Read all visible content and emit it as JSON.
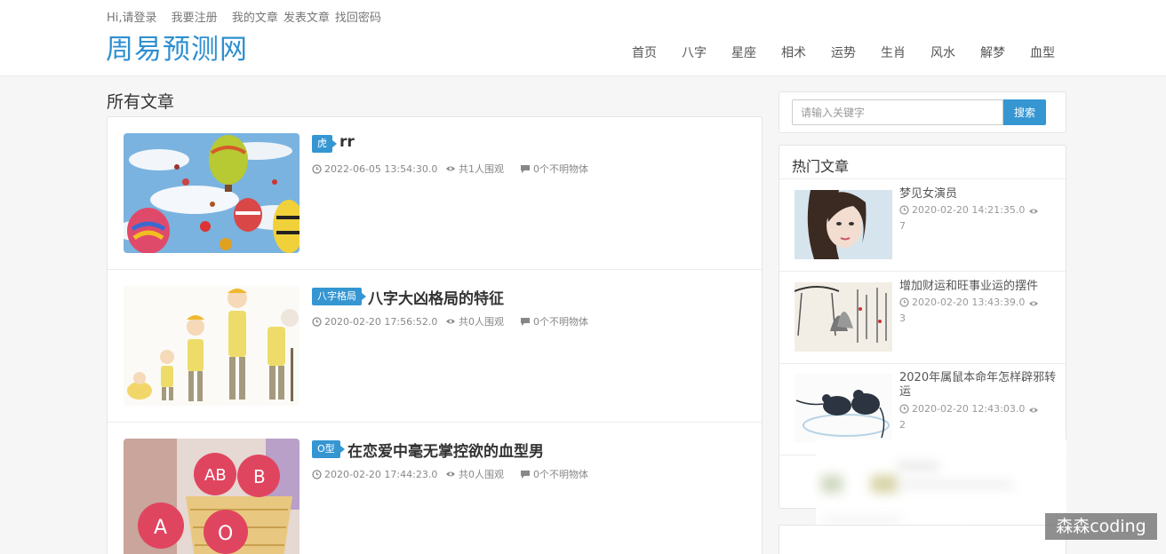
{
  "header": {
    "toplinks": [
      "Hi,请登录",
      "我要注册",
      "我的文章",
      "发表文章",
      "找回密码"
    ],
    "logo": "周易预测网",
    "nav": [
      "首页",
      "八字",
      "星座",
      "相术",
      "运势",
      "生肖",
      "风水",
      "解梦",
      "血型"
    ]
  },
  "main": {
    "section_title": "所有文章",
    "articles": [
      {
        "category": "虎",
        "title": "rr",
        "date": "2022-06-05 13:54:30.0",
        "views": "共1人围观",
        "comments": "0个不明物体"
      },
      {
        "category": "八字格局",
        "title": "八字大凶格局的特征",
        "date": "2020-02-20 17:56:52.0",
        "views": "共0人围观",
        "comments": "0个不明物体"
      },
      {
        "category": "O型",
        "title": "在恋爱中毫无掌控欲的血型男",
        "date": "2020-02-20 17:44:23.0",
        "views": "共0人围观",
        "comments": "0个不明物体"
      }
    ]
  },
  "sidebar": {
    "search": {
      "placeholder": "请输入关键字",
      "button": "搜索"
    },
    "hot_title": "热门文章",
    "hot": [
      {
        "title": "梦见女演员",
        "date": "2020-02-20 14:21:35.0",
        "count": "7"
      },
      {
        "title": "增加财运和旺事业运的摆件",
        "date": "2020-02-20 13:43:39.0",
        "count": "3"
      },
      {
        "title": "2020年属鼠本命年怎样辟邪转运",
        "date": "2020-02-20 12:43:03.0",
        "count": "2"
      }
    ]
  },
  "watermark": "森森coding",
  "colors": {
    "accent": "#3596d2",
    "logo": "#2f8fd0"
  }
}
